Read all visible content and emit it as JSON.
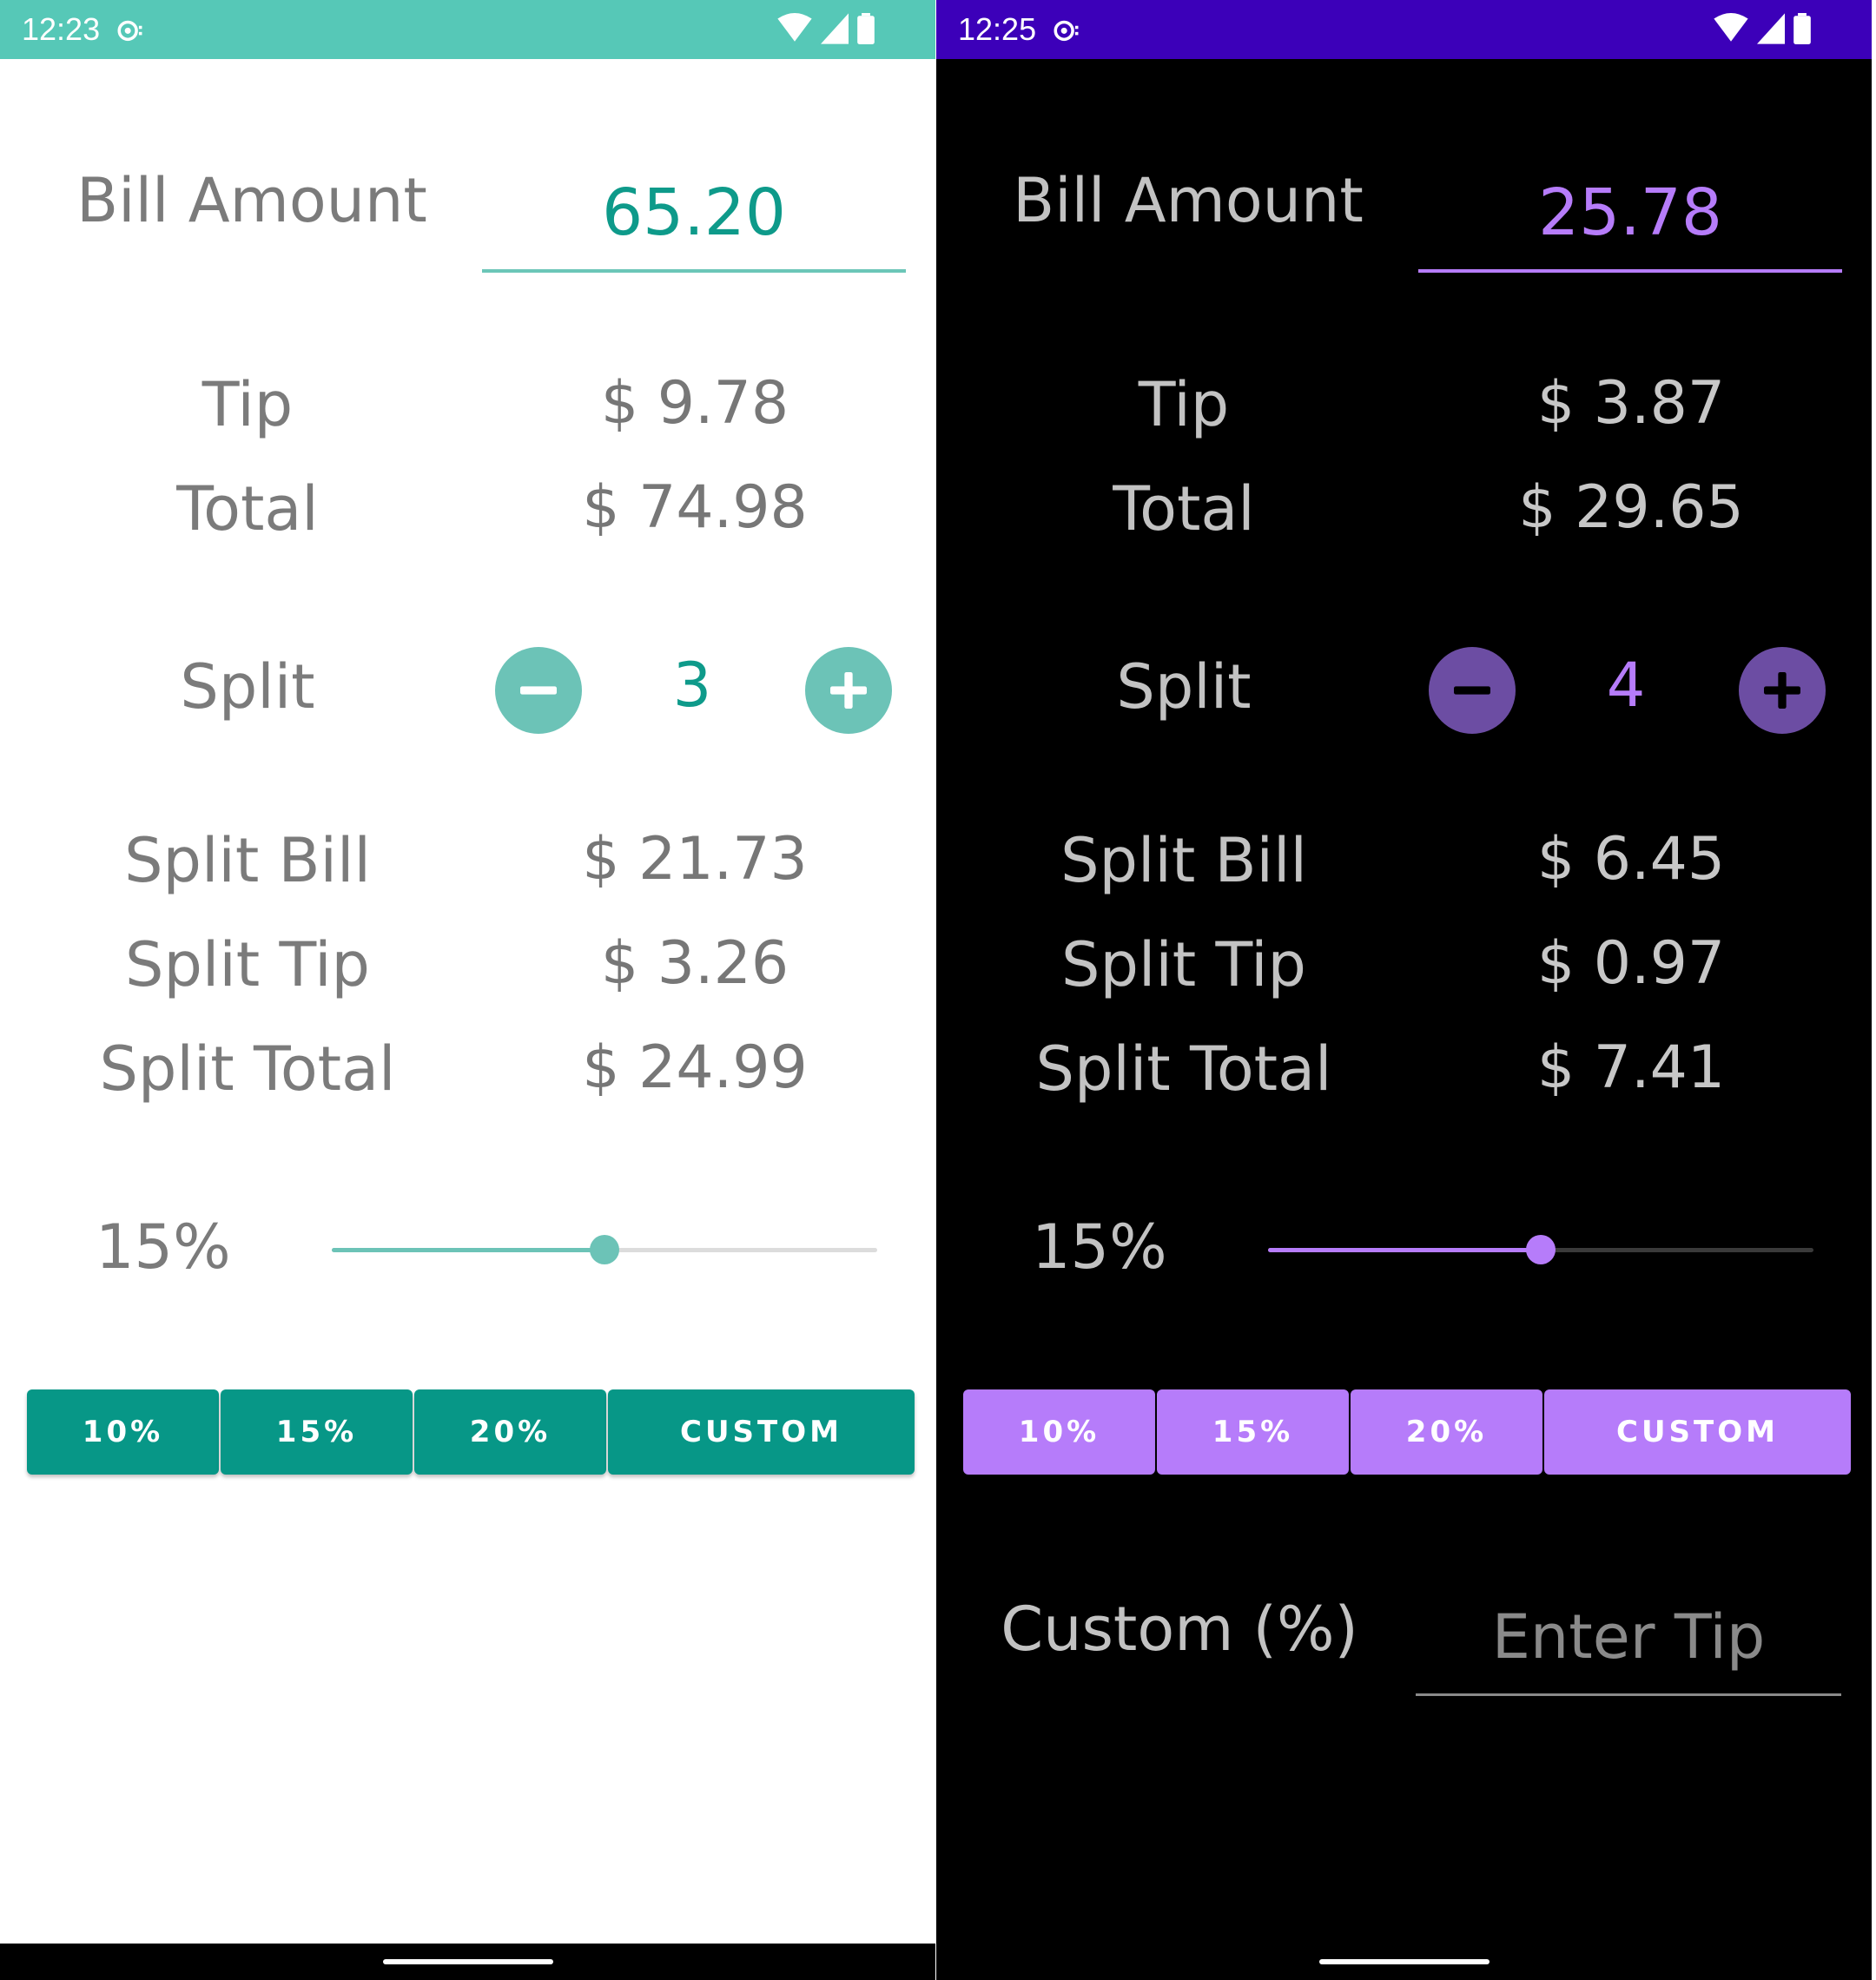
{
  "light": {
    "status": {
      "time": "12:23"
    },
    "bill_label": "Bill Amount",
    "bill_value": "65.20",
    "tip_label": "Tip",
    "tip_value": "$ 9.78",
    "total_label": "Total",
    "total_value": "$ 74.98",
    "split_label": "Split",
    "split_count": "3",
    "split_bill_label": "Split Bill",
    "split_bill_value": "$ 21.73",
    "split_tip_label": "Split Tip",
    "split_tip_value": "$ 3.26",
    "split_total_label": "Split Total",
    "split_total_value": "$ 24.99",
    "tip_percent": "15%",
    "slider_fraction": 0.5,
    "buttons": [
      "10%",
      "15%",
      "20%",
      "CUSTOM"
    ],
    "colors": {
      "accent": "#0e9a8a",
      "statusbar": "#56c8b7",
      "button": "#079787"
    }
  },
  "dark": {
    "status": {
      "time": "12:25"
    },
    "bill_label": "Bill Amount",
    "bill_value": "25.78",
    "tip_label": "Tip",
    "tip_value": "$ 3.87",
    "total_label": "Total",
    "total_value": "$ 29.65",
    "split_label": "Split",
    "split_count": "4",
    "split_bill_label": "Split Bill",
    "split_bill_value": "$ 6.45",
    "split_tip_label": "Split Tip",
    "split_tip_value": "$ 0.97",
    "split_total_label": "Split Total",
    "split_total_value": "$ 7.41",
    "tip_percent": "15%",
    "slider_fraction": 0.5,
    "buttons": [
      "10%",
      "15%",
      "20%",
      "CUSTOM"
    ],
    "custom_label": "Custom (%)",
    "custom_placeholder": "Enter Tip",
    "colors": {
      "accent": "#b67cfa",
      "statusbar": "#3c00b9",
      "button": "#b67cfa"
    }
  },
  "icons": [
    "cast-icon",
    "wifi-icon",
    "cellular-signal-icon",
    "battery-icon",
    "minus-icon",
    "plus-icon"
  ]
}
